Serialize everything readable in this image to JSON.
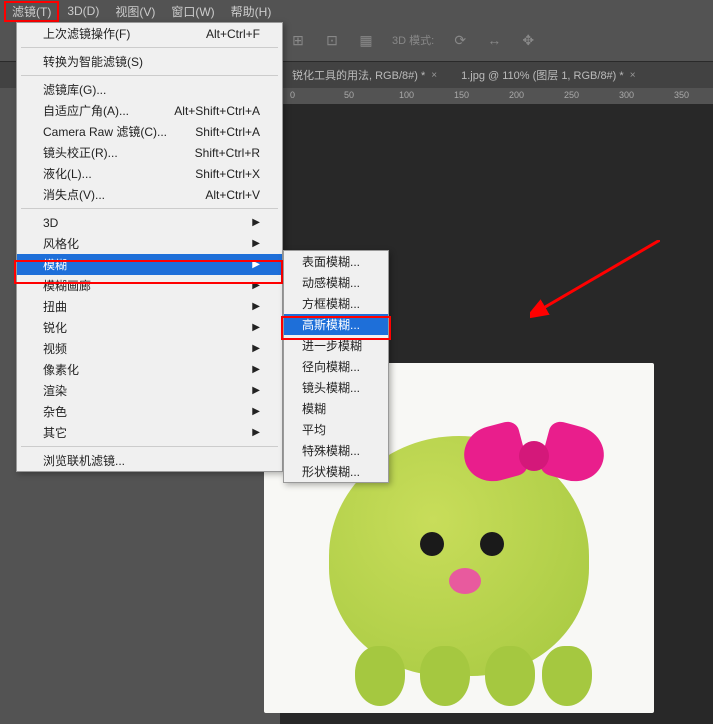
{
  "menubar": {
    "items": [
      {
        "label": "滤镜(T)",
        "highlighted": true
      },
      {
        "label": "3D(D)"
      },
      {
        "label": "视图(V)"
      },
      {
        "label": "窗口(W)"
      },
      {
        "label": "帮助(H)"
      }
    ]
  },
  "toolbar": {
    "mode_label": "3D 模式:"
  },
  "tabs": [
    {
      "label": "锐化工具的用法, RGB/8#) *"
    },
    {
      "label": "1.jpg @ 110% (图层 1, RGB/8#) *"
    }
  ],
  "ruler": {
    "ticks": [
      "0",
      "50",
      "100",
      "150",
      "200",
      "250",
      "300",
      "350"
    ]
  },
  "main_menu": {
    "sections": [
      [
        {
          "label": "上次滤镜操作(F)",
          "shortcut": "Alt+Ctrl+F"
        }
      ],
      [
        {
          "label": "转换为智能滤镜(S)",
          "shortcut": ""
        }
      ],
      [
        {
          "label": "滤镜库(G)...",
          "shortcut": ""
        },
        {
          "label": "自适应广角(A)...",
          "shortcut": "Alt+Shift+Ctrl+A"
        },
        {
          "label": "Camera Raw 滤镜(C)...",
          "shortcut": "Shift+Ctrl+A"
        },
        {
          "label": "镜头校正(R)...",
          "shortcut": "Shift+Ctrl+R"
        },
        {
          "label": "液化(L)...",
          "shortcut": "Shift+Ctrl+X"
        },
        {
          "label": "消失点(V)...",
          "shortcut": "Alt+Ctrl+V"
        }
      ],
      [
        {
          "label": "3D",
          "submenu": true
        },
        {
          "label": "风格化",
          "submenu": true
        },
        {
          "label": "模糊",
          "submenu": true,
          "selected": true
        },
        {
          "label": "模糊画廊",
          "submenu": true
        },
        {
          "label": "扭曲",
          "submenu": true
        },
        {
          "label": "锐化",
          "submenu": true
        },
        {
          "label": "视频",
          "submenu": true
        },
        {
          "label": "像素化",
          "submenu": true
        },
        {
          "label": "渲染",
          "submenu": true
        },
        {
          "label": "杂色",
          "submenu": true
        },
        {
          "label": "其它",
          "submenu": true
        }
      ],
      [
        {
          "label": "浏览联机滤镜...",
          "shortcut": ""
        }
      ]
    ]
  },
  "sub_menu": {
    "sections": [
      [
        {
          "label": "表面模糊..."
        },
        {
          "label": "动感模糊..."
        },
        {
          "label": "方框模糊..."
        },
        {
          "label": "高斯模糊...",
          "selected": true
        },
        {
          "label": "进一步模糊"
        },
        {
          "label": "径向模糊..."
        },
        {
          "label": "镜头模糊..."
        },
        {
          "label": "模糊"
        },
        {
          "label": "平均"
        },
        {
          "label": "特殊模糊..."
        },
        {
          "label": "形状模糊..."
        }
      ]
    ]
  }
}
